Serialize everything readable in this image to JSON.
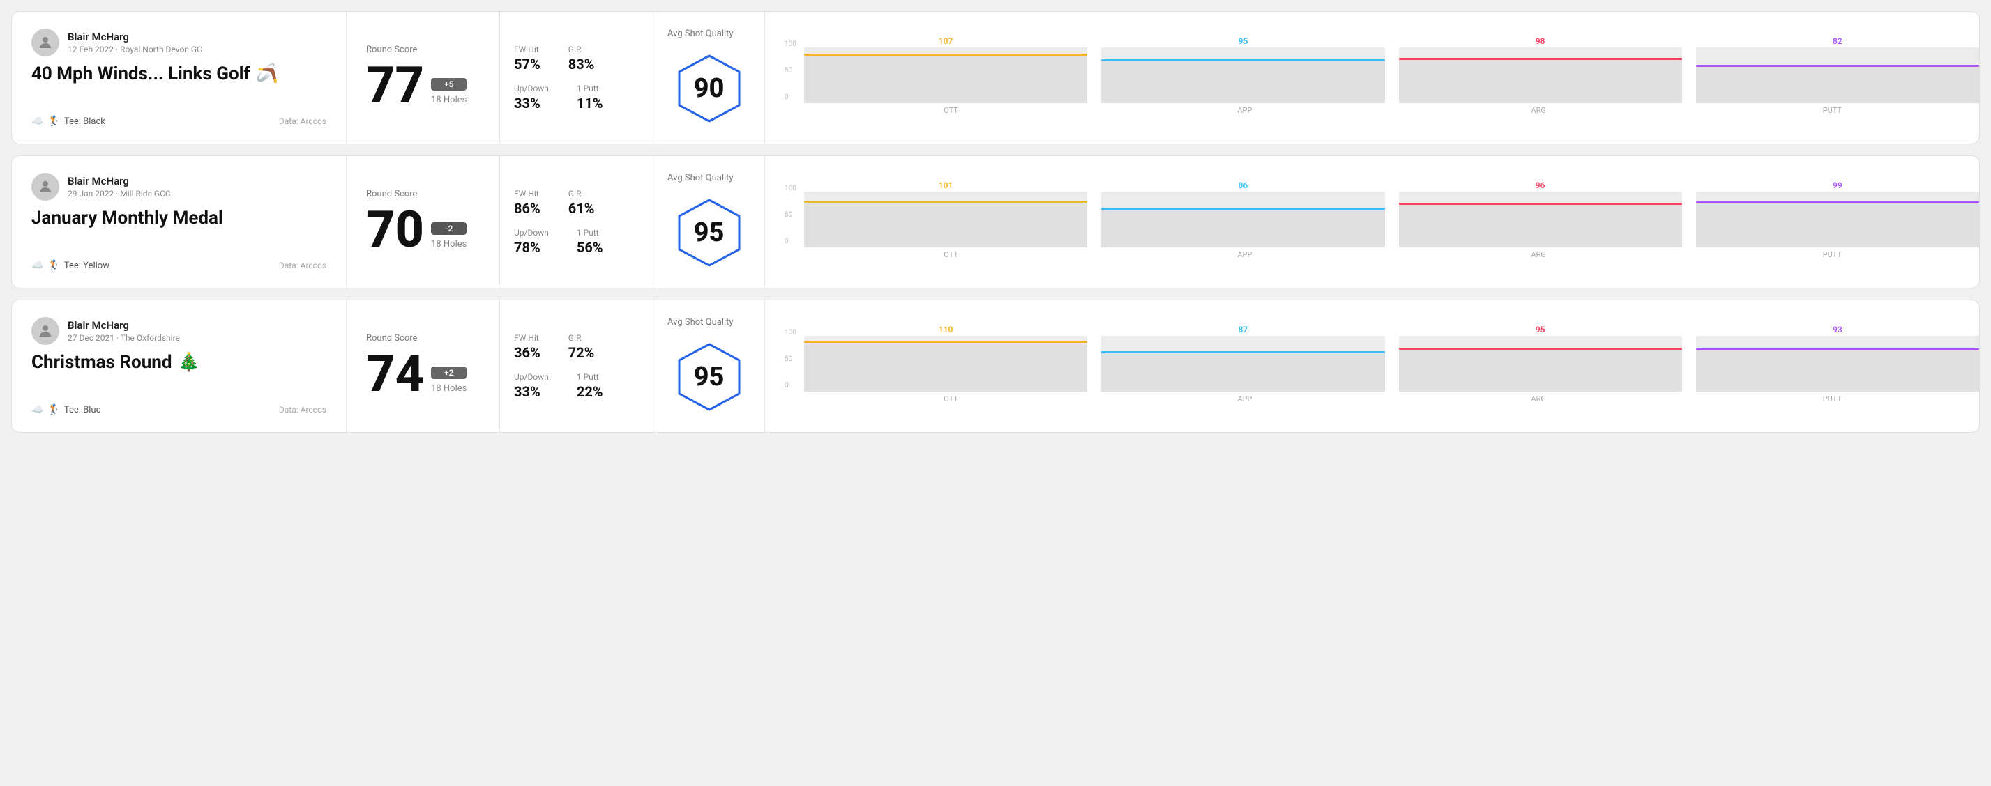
{
  "rounds": [
    {
      "id": "round-1",
      "player": "Blair McHarg",
      "date": "12 Feb 2022 · Royal North Devon GC",
      "title": "40 Mph Winds... Links Golf",
      "title_emoji": "🪃",
      "tee": "Black",
      "data_source": "Data: Arccos",
      "score": 77,
      "score_diff": "+5",
      "score_diff_type": "positive",
      "holes": "18 Holes",
      "fw_hit": "57%",
      "gir": "83%",
      "up_down": "33%",
      "one_putt": "11%",
      "avg_quality": 90,
      "quality_label": "Avg Shot Quality",
      "chart": {
        "bars": [
          {
            "label": "OTT",
            "value": 107,
            "max": 120,
            "color": "#f0b429",
            "line_color": "#f0b429"
          },
          {
            "label": "APP",
            "value": 95,
            "max": 120,
            "color": "#38bdf8",
            "line_color": "#38bdf8"
          },
          {
            "label": "ARG",
            "value": 98,
            "max": 120,
            "color": "#f43f5e",
            "line_color": "#f43f5e"
          },
          {
            "label": "PUTT",
            "value": 82,
            "max": 120,
            "color": "#a855f7",
            "line_color": "#a855f7"
          }
        ],
        "y_labels": [
          "100",
          "50",
          "0"
        ]
      }
    },
    {
      "id": "round-2",
      "player": "Blair McHarg",
      "date": "29 Jan 2022 · Mill Ride GCC",
      "title": "January Monthly Medal",
      "title_emoji": "",
      "tee": "Yellow",
      "data_source": "Data: Arccos",
      "score": 70,
      "score_diff": "-2",
      "score_diff_type": "negative",
      "holes": "18 Holes",
      "fw_hit": "86%",
      "gir": "61%",
      "up_down": "78%",
      "one_putt": "56%",
      "avg_quality": 95,
      "quality_label": "Avg Shot Quality",
      "chart": {
        "bars": [
          {
            "label": "OTT",
            "value": 101,
            "max": 120,
            "color": "#f0b429",
            "line_color": "#f0b429"
          },
          {
            "label": "APP",
            "value": 86,
            "max": 120,
            "color": "#38bdf8",
            "line_color": "#38bdf8"
          },
          {
            "label": "ARG",
            "value": 96,
            "max": 120,
            "color": "#f43f5e",
            "line_color": "#f43f5e"
          },
          {
            "label": "PUTT",
            "value": 99,
            "max": 120,
            "color": "#a855f7",
            "line_color": "#a855f7"
          }
        ],
        "y_labels": [
          "100",
          "50",
          "0"
        ]
      }
    },
    {
      "id": "round-3",
      "player": "Blair McHarg",
      "date": "27 Dec 2021 · The Oxfordshire",
      "title": "Christmas Round",
      "title_emoji": "🎄",
      "tee": "Blue",
      "data_source": "Data: Arccos",
      "score": 74,
      "score_diff": "+2",
      "score_diff_type": "positive",
      "holes": "18 Holes",
      "fw_hit": "36%",
      "gir": "72%",
      "up_down": "33%",
      "one_putt": "22%",
      "avg_quality": 95,
      "quality_label": "Avg Shot Quality",
      "chart": {
        "bars": [
          {
            "label": "OTT",
            "value": 110,
            "max": 120,
            "color": "#f0b429",
            "line_color": "#f0b429"
          },
          {
            "label": "APP",
            "value": 87,
            "max": 120,
            "color": "#38bdf8",
            "line_color": "#38bdf8"
          },
          {
            "label": "ARG",
            "value": 95,
            "max": 120,
            "color": "#f43f5e",
            "line_color": "#f43f5e"
          },
          {
            "label": "PUTT",
            "value": 93,
            "max": 120,
            "color": "#a855f7",
            "line_color": "#a855f7"
          }
        ],
        "y_labels": [
          "100",
          "50",
          "0"
        ]
      }
    }
  ],
  "labels": {
    "round_score": "Round Score",
    "fw_hit": "FW Hit",
    "gir": "GIR",
    "up_down": "Up/Down",
    "one_putt": "1 Putt",
    "avg_quality": "Avg Shot Quality",
    "data_source": "Data: Arccos",
    "tee_prefix": "Tee:"
  }
}
